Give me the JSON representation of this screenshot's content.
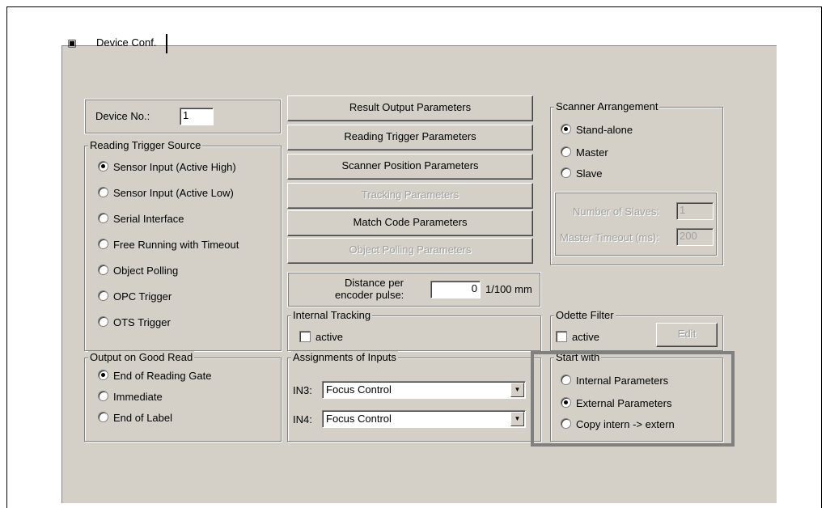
{
  "tab": {
    "label": "Device Conf.",
    "icon": "device-icon"
  },
  "device": {
    "label": "Device No.:",
    "value": "1"
  },
  "reading_trigger_source": {
    "title": "Reading Trigger Source",
    "options": [
      {
        "label": "Sensor Input (Active High)",
        "selected": true
      },
      {
        "label": "Sensor Input (Active Low)",
        "selected": false
      },
      {
        "label": "Serial Interface",
        "selected": false
      },
      {
        "label": "Free Running with Timeout",
        "selected": false
      },
      {
        "label": "Object Polling",
        "selected": false
      },
      {
        "label": "OPC Trigger",
        "selected": false
      },
      {
        "label": "OTS Trigger",
        "selected": false
      }
    ]
  },
  "output_good_read": {
    "title": "Output on Good Read",
    "options": [
      {
        "label": "End of Reading Gate",
        "selected": true
      },
      {
        "label": "Immediate",
        "selected": false
      },
      {
        "label": "End of Label",
        "selected": false
      }
    ]
  },
  "buttons": {
    "result_output": "Result Output Parameters",
    "reading_trigger": "Reading Trigger Parameters",
    "scanner_position": "Scanner Position Parameters",
    "tracking": "Tracking Parameters",
    "match_code": "Match Code Parameters",
    "object_polling": "Object Polling Parameters",
    "edit": "Edit"
  },
  "distance": {
    "label_line1": "Distance per",
    "label_line2": "encoder pulse:",
    "value": "0",
    "unit": "1/100 mm"
  },
  "internal_tracking": {
    "title": "Internal Tracking",
    "checkbox_label": "active"
  },
  "assignments": {
    "title": "Assignments of Inputs",
    "in3_label": "IN3:",
    "in3_value": "Focus Control",
    "in4_label": "IN4:",
    "in4_value": "Focus Control"
  },
  "scanner_arrangement": {
    "title": "Scanner Arrangement",
    "options": [
      {
        "label": "Stand-alone",
        "selected": true
      },
      {
        "label": "Master",
        "selected": false
      },
      {
        "label": "Slave",
        "selected": false
      }
    ],
    "slaves_label": "Number of Slaves:",
    "slaves_value": "1",
    "timeout_label": "Master Timeout (ms):",
    "timeout_value": "200"
  },
  "odette_filter": {
    "title": "Odette Filter",
    "checkbox_label": "active"
  },
  "start_with": {
    "title": "Start with",
    "options": [
      {
        "label": "Internal Parameters",
        "selected": false
      },
      {
        "label": "External Parameters",
        "selected": true
      },
      {
        "label": "Copy intern -> extern",
        "selected": false
      }
    ]
  }
}
